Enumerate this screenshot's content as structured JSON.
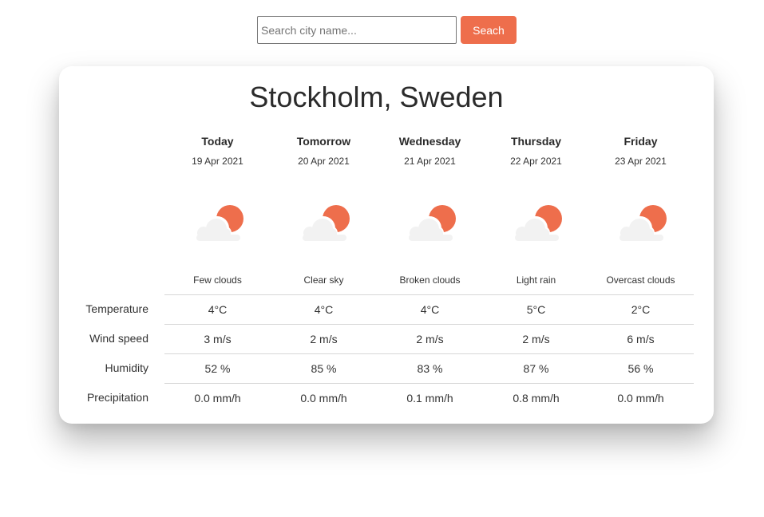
{
  "search": {
    "placeholder": "Search city name...",
    "value": "",
    "button_label": "Seach"
  },
  "colors": {
    "accent": "#ee6e4c",
    "cloud": "#f2f2f2"
  },
  "location": "Stockholm, Sweden",
  "row_labels": [
    "Temperature",
    "Wind speed",
    "Humidity",
    "Precipitation"
  ],
  "days": [
    {
      "name": "Today",
      "date": "19 Apr 2021",
      "icon": "cloud-sun-icon",
      "description": "Few clouds",
      "temperature": "4°C",
      "wind": "3 m/s",
      "humidity": "52 %",
      "precipitation": "0.0 mm/h"
    },
    {
      "name": "Tomorrow",
      "date": "20 Apr 2021",
      "icon": "cloud-sun-icon",
      "description": "Clear sky",
      "temperature": "4°C",
      "wind": "2 m/s",
      "humidity": "85 %",
      "precipitation": "0.0 mm/h"
    },
    {
      "name": "Wednesday",
      "date": "21 Apr 2021",
      "icon": "cloud-sun-icon",
      "description": "Broken clouds",
      "temperature": "4°C",
      "wind": "2 m/s",
      "humidity": "83 %",
      "precipitation": "0.1 mm/h"
    },
    {
      "name": "Thursday",
      "date": "22 Apr 2021",
      "icon": "cloud-sun-icon",
      "description": "Light rain",
      "temperature": "5°C",
      "wind": "2 m/s",
      "humidity": "87 %",
      "precipitation": "0.8 mm/h"
    },
    {
      "name": "Friday",
      "date": "23 Apr 2021",
      "icon": "cloud-sun-icon",
      "description": "Overcast clouds",
      "temperature": "2°C",
      "wind": "6 m/s",
      "humidity": "56 %",
      "precipitation": "0.0 mm/h"
    }
  ]
}
